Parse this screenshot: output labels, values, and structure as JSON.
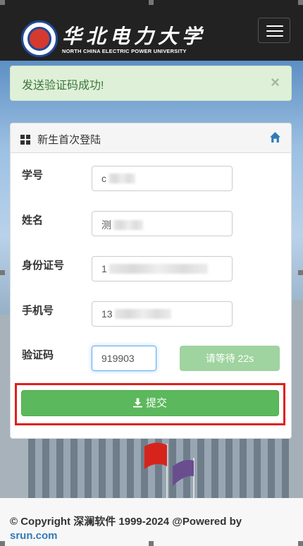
{
  "header": {
    "brand_cn": "华北电力大学",
    "brand_en": "NORTH CHINA ELECTRIC POWER UNIVERSITY",
    "logo_icon": "university-logo-icon",
    "menu_icon": "hamburger-menu-icon"
  },
  "alert": {
    "message": "发送验证码成功!",
    "close": "×"
  },
  "panel": {
    "title": "新生首次登陆",
    "title_icon": "grid-icon",
    "home_icon": "home-icon"
  },
  "form": {
    "student_id_label": "学号",
    "student_id_value": "c",
    "name_label": "姓名",
    "name_value": "测",
    "id_card_label": "身份证号",
    "id_card_value": "1",
    "phone_label": "手机号",
    "phone_value": "13",
    "code_label": "验证码",
    "code_value": "919903",
    "wait_button": "请等待 22s",
    "submit_button": "提交"
  },
  "footer": {
    "copyright": "© Copyright 深澜软件 1999-2024 @Powered by",
    "link": "srun.com"
  },
  "colors": {
    "topbar": "#222222",
    "alert_bg": "#dff0d8",
    "alert_text": "#3c763d",
    "success": "#5cb85c",
    "disabled_success": "#9fd39f",
    "highlight": "#e0201a",
    "link": "#337ab7"
  }
}
